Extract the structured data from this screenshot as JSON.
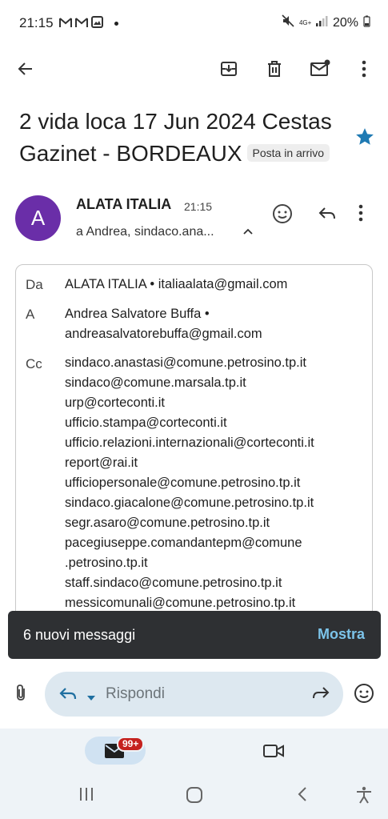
{
  "status_bar": {
    "time": "21:15",
    "network_label": "4G+",
    "battery_percent": "20%",
    "left_icons": [
      "gmail-icon",
      "gmail-icon",
      "image-icon"
    ],
    "right_icons": [
      "mute-icon",
      "signal-icon",
      "battery-icon"
    ]
  },
  "toolbar": {
    "icons": [
      "back-arrow-icon",
      "archive-icon",
      "delete-icon",
      "mark-unread-icon",
      "more-vert-icon"
    ]
  },
  "email": {
    "subject": "2 vida loca 17 Jun 2024 Cestas Gazinet - BORDEAUX",
    "label": "Posta in arrivo",
    "starred": true,
    "star_color": "#1a73e8",
    "avatar_letter": "A",
    "avatar_color": "#6a2ea8",
    "sender": "ALATA ITALIA",
    "time": "21:15",
    "recipients_summary": "a Andrea, sindaco.ana..."
  },
  "details": {
    "from_label": "Da",
    "from_value": "ALATA ITALIA • italiaalata@gmail.com",
    "to_label": "A",
    "to_line1": "Andrea Salvatore Buffa •",
    "to_line2": "andreasalvatorebuffa@gmail.com",
    "cc_label": "Cc",
    "cc": [
      "sindaco.anastasi@comune.petrosino.tp.it",
      "sindaco@comune.marsala.tp.it",
      "urp@corteconti.it",
      "ufficio.stampa@corteconti.it",
      "ufficio.relazioni.internazionali@corteconti.it",
      "report@rai.it",
      "ufficiopersonale@comune.petrosino.tp.it",
      "sindaco.giacalone@comune.petrosino.tp.it",
      "segr.asaro@comune.petrosino.tp.it",
      "pacegiuseppe.comandantepm@comune",
      ".petrosino.tp.it",
      "staff.sindaco@comune.petrosino.tp.it",
      "messicomunali@comune.petrosino.tp.it"
    ]
  },
  "snackbar": {
    "text": "6 nuovi messaggi",
    "action": "Mostra"
  },
  "reply_bar": {
    "placeholder": "Rispondi"
  },
  "bottom_nav": {
    "mail_badge": "99+"
  }
}
